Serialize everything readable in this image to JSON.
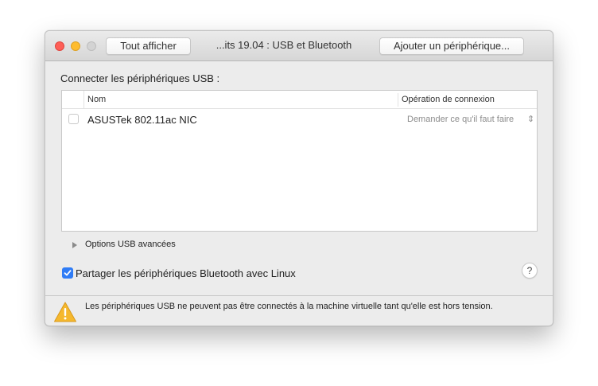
{
  "window": {
    "title": "...its 19.04 : USB et Bluetooth",
    "show_all_label": "Tout afficher",
    "add_device_label": "Ajouter un périphérique..."
  },
  "usb": {
    "section_label": "Connecter les périphériques USB :",
    "columns": {
      "name": "Nom",
      "operation": "Opération de connexion"
    },
    "devices": [
      {
        "name": "ASUSTek 802.11ac NIC",
        "operation": "Demander ce qu'il faut faire",
        "checked": false
      }
    ],
    "advanced_label": "Options USB avancées"
  },
  "bluetooth": {
    "share_label": "Partager les périphériques Bluetooth avec Linux",
    "checked": true
  },
  "help_label": "?",
  "footer": {
    "warning_text": "Les périphériques USB ne peuvent pas être connectés à la machine virtuelle tant qu'elle est hors tension.",
    "icon": "warning-icon"
  },
  "colors": {
    "accent": "#2f7cf6",
    "close": "#fe5f57",
    "minimize": "#febc2e",
    "warning": "#f5b82e"
  }
}
